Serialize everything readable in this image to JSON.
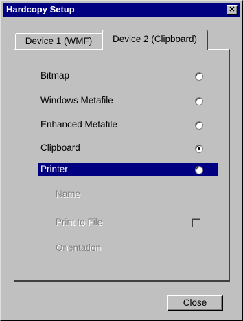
{
  "window": {
    "title": "Hardcopy Setup",
    "close_glyph": "✕"
  },
  "tabs": [
    {
      "label": "Device 1 (WMF)",
      "active": false
    },
    {
      "label": "Device 2 (Clipboard)",
      "active": true
    }
  ],
  "options": [
    {
      "label": "Bitmap",
      "checked": false
    },
    {
      "label": "Windows Metafile",
      "checked": false
    },
    {
      "label": "Enhanced Metafile",
      "checked": false
    },
    {
      "label": "Clipboard",
      "checked": true
    },
    {
      "label": "Printer",
      "checked": false,
      "selected": true
    }
  ],
  "printer_settings": {
    "name_label": "Name",
    "print_to_file_label": "Print to File",
    "print_to_file_checked": false,
    "orientation_label": "Orientation"
  },
  "buttons": {
    "close_label": "Close"
  },
  "colors": {
    "titlebar": "#000080",
    "face": "#c0c0c0",
    "selection": "#000080"
  }
}
